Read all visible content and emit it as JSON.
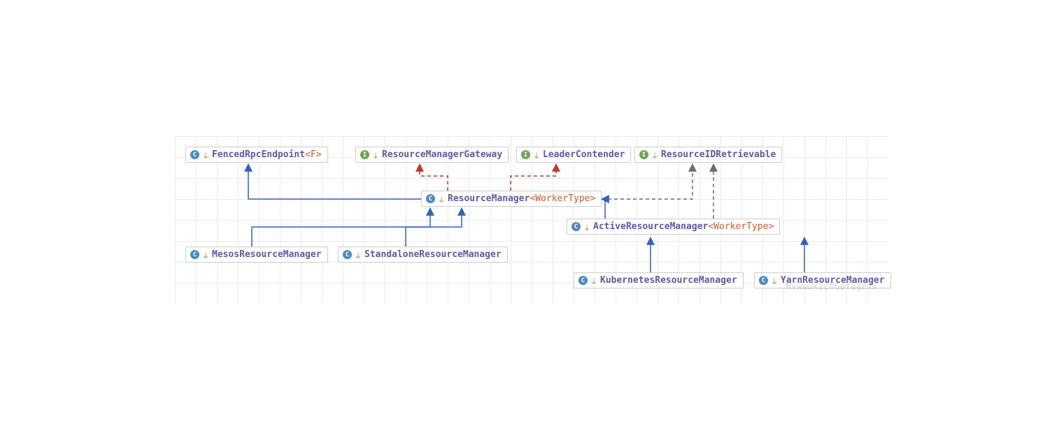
{
  "nodes": {
    "fenced": {
      "kind": "class",
      "name": "FencedRpcEndpoint",
      "generic": "<F>"
    },
    "gateway": {
      "kind": "interface",
      "name": "ResourceManagerGateway",
      "generic": ""
    },
    "leader": {
      "kind": "interface",
      "name": "LeaderContender",
      "generic": ""
    },
    "retr": {
      "kind": "interface",
      "name": "ResourceIDRetrievable",
      "generic": ""
    },
    "rm": {
      "kind": "class",
      "name": "ResourceManager",
      "generic": "<WorkerType>"
    },
    "mesos": {
      "kind": "class",
      "name": "MesosResourceManager",
      "generic": ""
    },
    "stand": {
      "kind": "class",
      "name": "StandaloneResourceManager",
      "generic": ""
    },
    "active": {
      "kind": "class",
      "name": "ActiveResourceManager",
      "generic": "<WorkerType>"
    },
    "k8s": {
      "kind": "class",
      "name": "KubernetesResourceManager",
      "generic": ""
    },
    "yarn": {
      "kind": "class",
      "name": "YarnResourceManager",
      "generic": ""
    }
  },
  "edges": [
    {
      "from": "rm",
      "to": "fenced",
      "style": "extends"
    },
    {
      "from": "rm",
      "to": "gateway",
      "style": "implements"
    },
    {
      "from": "rm",
      "to": "leader",
      "style": "implements"
    },
    {
      "from": "rm",
      "to": "retr",
      "style": "implements"
    },
    {
      "from": "mesos",
      "to": "rm",
      "style": "extends"
    },
    {
      "from": "stand",
      "to": "rm",
      "style": "extends"
    },
    {
      "from": "active",
      "to": "rm",
      "style": "extends"
    },
    {
      "from": "k8s",
      "to": "active",
      "style": "extends"
    },
    {
      "from": "yarn",
      "to": "active",
      "style": "extends"
    }
  ],
  "badges": {
    "class": "C",
    "interface": "I"
  },
  "connector": "⏚",
  "watermark": "NvwwuxzchGafagexx"
}
